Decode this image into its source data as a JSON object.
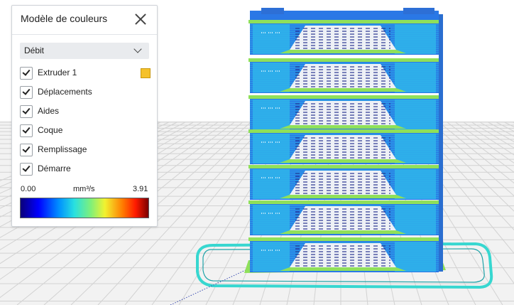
{
  "panel": {
    "title": "Modèle de couleurs",
    "close_icon": "close-icon",
    "dropdown": {
      "selected": "Débit"
    },
    "checkboxes": [
      {
        "label": "Extruder 1",
        "checked": true,
        "swatch_color": "#f5c12a"
      },
      {
        "label": "Déplacements",
        "checked": true
      },
      {
        "label": "Aides",
        "checked": true
      },
      {
        "label": "Coque",
        "checked": true
      },
      {
        "label": "Remplissage",
        "checked": true
      },
      {
        "label": "Démarre",
        "checked": true
      }
    ],
    "legend": {
      "min": "0.00",
      "unit": "mm³/s",
      "max": "3.91"
    }
  },
  "colors": {
    "shell_blue": "#2a78e6",
    "shell_cyan": "#2de0e8",
    "infill_green": "#8fe05a",
    "grid_bg": "#f3f3f3",
    "travel_cyan": "#37d7d0"
  }
}
